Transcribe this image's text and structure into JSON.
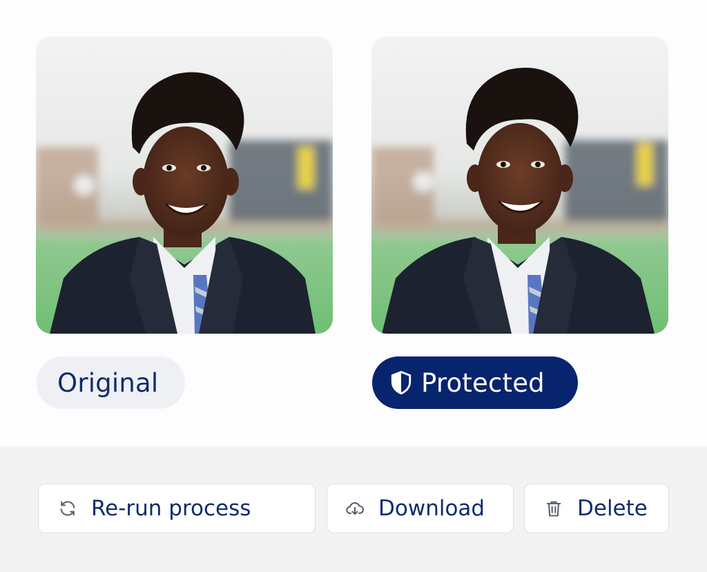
{
  "comparison": {
    "original_label": "Original",
    "protected_label": "Protected"
  },
  "actions": {
    "rerun_label": "Re-run process",
    "download_label": "Download",
    "delete_label": "Delete"
  },
  "icons": {
    "protected": "shield-icon",
    "rerun": "refresh-icon",
    "download": "cloud-download-icon",
    "delete": "trash-icon"
  },
  "colors": {
    "brand_navy": "#07246f",
    "text_navy": "#0e2c6e",
    "pill_gray": "#eef0f4",
    "footer_bg": "#f3f3f4"
  }
}
